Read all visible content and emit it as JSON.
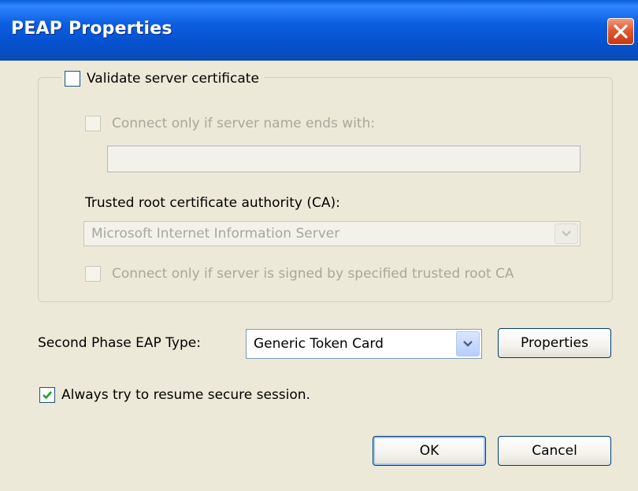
{
  "window": {
    "title": "PEAP Properties",
    "close_icon": "close-icon"
  },
  "validate_group": {
    "checkbox_label": "Validate server certificate",
    "checked": false,
    "connect_server_name_label": "Connect only if server name ends with:",
    "server_name_value": "",
    "trusted_ca_label": "Trusted root certificate authority (CA):",
    "trusted_ca_selected": "Microsoft Internet Information Server",
    "connect_signed_label": "Connect only if server is signed by specified trusted root CA"
  },
  "second_phase": {
    "label": "Second Phase EAP Type:",
    "selected": "Generic Token Card",
    "properties_button": "Properties"
  },
  "resume_session": {
    "label": "Always try to resume secure session.",
    "checked": true
  },
  "buttons": {
    "ok": "OK",
    "cancel": "Cancel"
  },
  "colors": {
    "titlebar": "#0a5fd8",
    "dialog_bg": "#ece9d8",
    "close_button": "#e05a30",
    "check_green": "#21a121"
  }
}
